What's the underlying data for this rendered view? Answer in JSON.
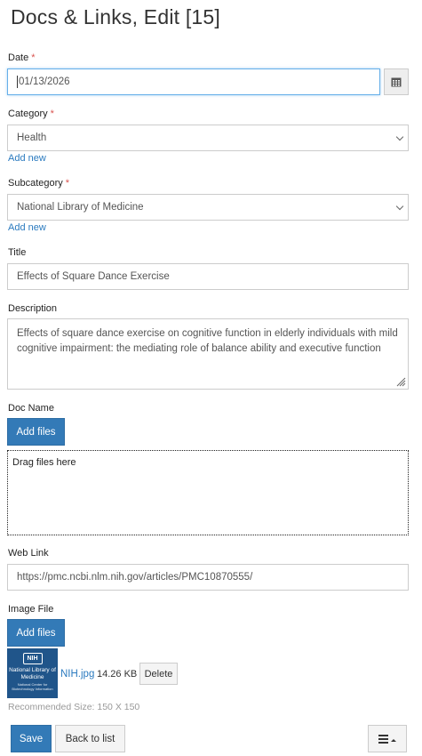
{
  "page": {
    "title": "Docs & Links, Edit [15]"
  },
  "date": {
    "label": "Date",
    "required_mark": "*",
    "value": "01/13/2026",
    "picker_icon": "calendar-icon"
  },
  "category": {
    "label": "Category",
    "required_mark": "*",
    "selected": "Health",
    "add_new": "Add new"
  },
  "subcategory": {
    "label": "Subcategory",
    "required_mark": "*",
    "selected": "National Library of Medicine",
    "add_new": "Add new"
  },
  "title_field": {
    "label": "Title",
    "value": "Effects of Square Dance Exercise"
  },
  "description": {
    "label": "Description",
    "value": "Effects of square dance exercise on cognitive function in elderly individuals with mild cognitive impairment: the mediating role of balance ability and executive function"
  },
  "doc_name": {
    "label": "Doc Name",
    "add_files": "Add files",
    "dropzone": "Drag files here"
  },
  "web_link": {
    "label": "Web Link",
    "value": "https://pmc.ncbi.nlm.nih.gov/articles/PMC10870555/"
  },
  "image_file": {
    "label": "Image File",
    "add_files": "Add files",
    "thumbnail": {
      "badge": "NIH",
      "line1": "National Library of Medicine",
      "line2": "National Center for Biotechnology Information"
    },
    "file_name": "NIH.jpg",
    "file_size": "14.26 KB",
    "delete": "Delete",
    "hint": "Recommended Size: 150 X 150"
  },
  "footer": {
    "save": "Save",
    "back": "Back to list",
    "menu_icon": "hamburger-menu-icon"
  },
  "colors": {
    "primary": "#337ab7",
    "link": "#2a7abf",
    "required": "#d9534f",
    "focus": "#66afe9"
  }
}
